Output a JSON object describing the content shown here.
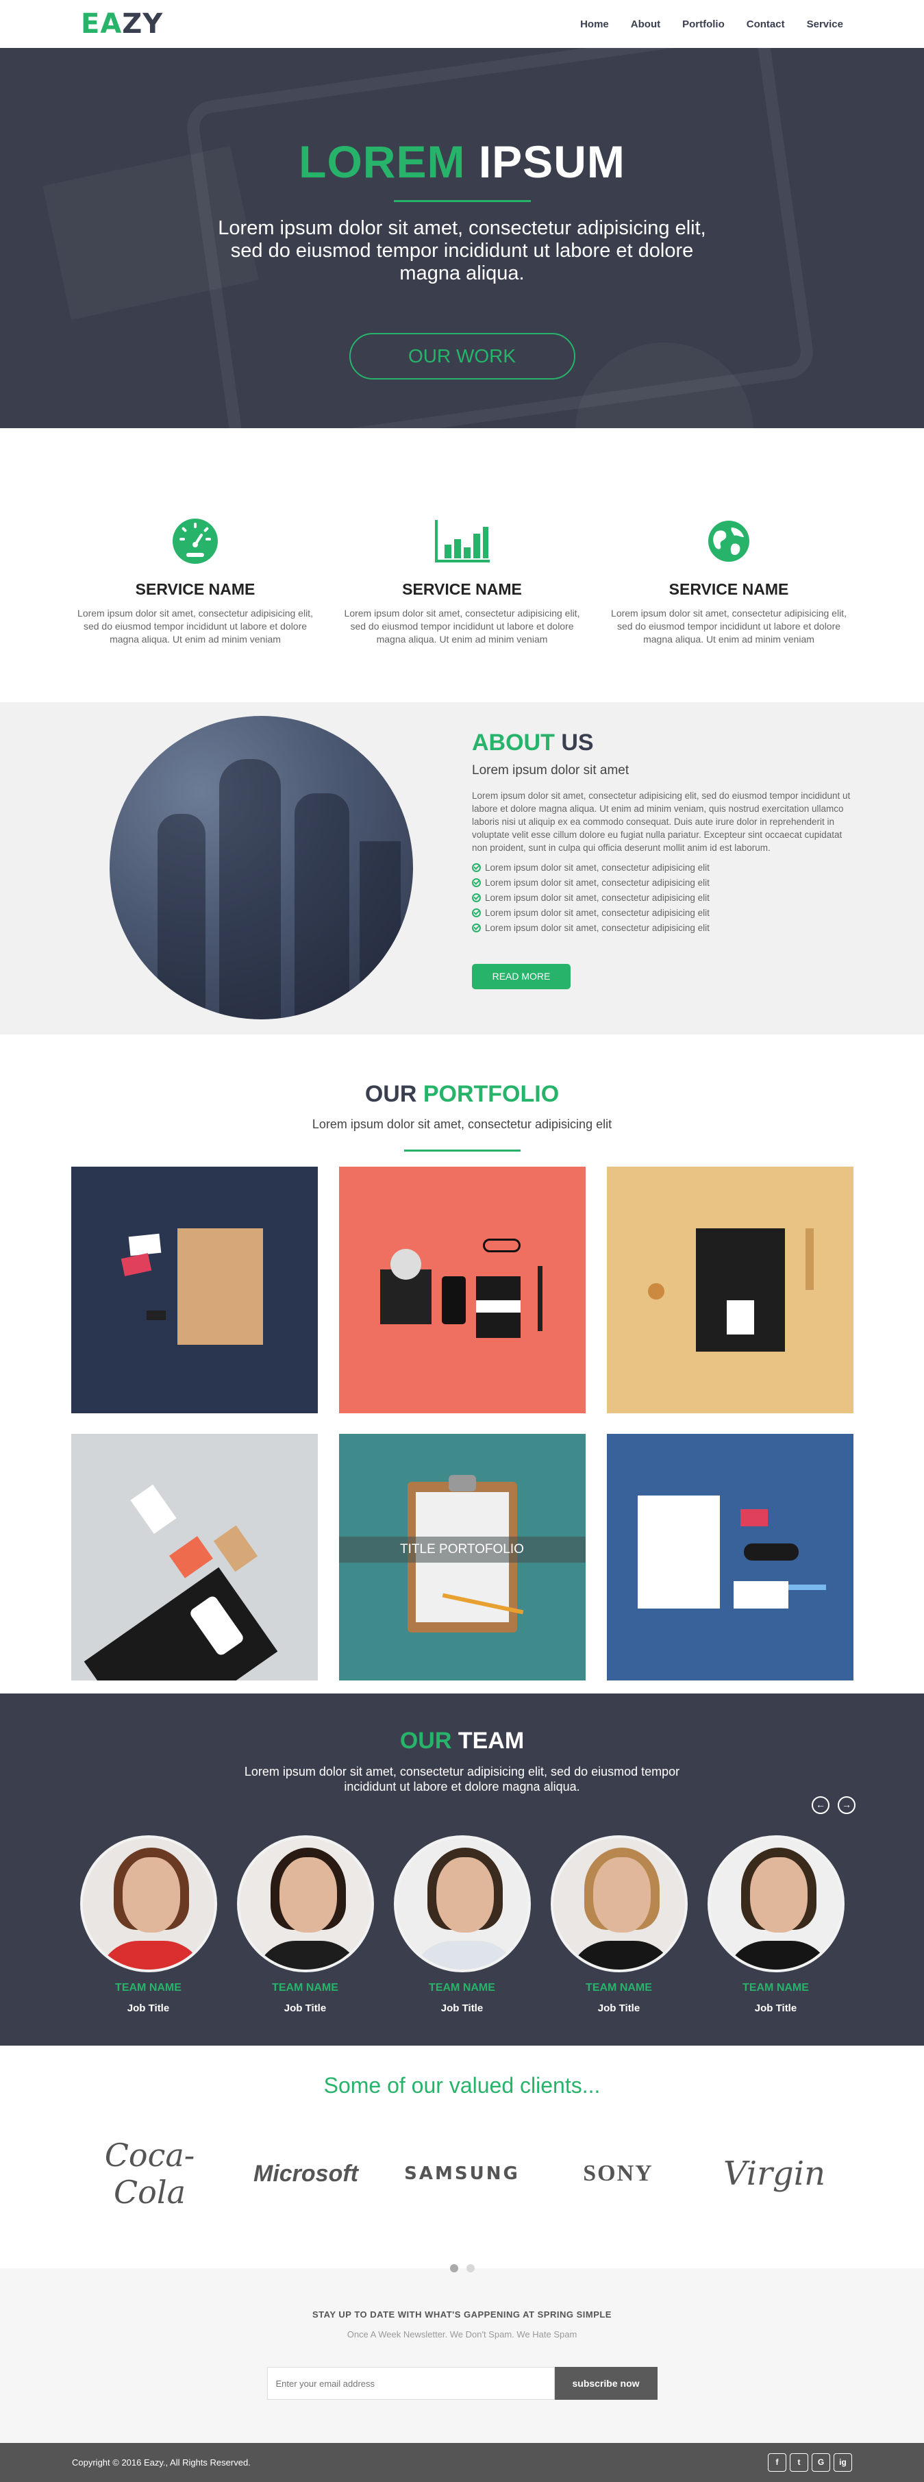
{
  "nav": {
    "logo_a": "EA",
    "logo_b": "ZY",
    "items": [
      "Home",
      "About",
      "Portfolio",
      "Contact",
      "Service"
    ]
  },
  "hero": {
    "title_green": "LOREM",
    "title_white": "IPSUM",
    "subtitle": "Lorem ipsum dolor sit amet, consectetur adipisicing elit, sed do eiusmod tempor incididunt ut labore et dolore magna aliqua.",
    "button": "OUR WORK"
  },
  "services": [
    {
      "icon": "gauge-icon",
      "title": "SERVICE NAME",
      "text": "Lorem ipsum dolor sit amet, consectetur adipisicing elit, sed do eiusmod tempor incididunt ut labore et dolore magna aliqua. Ut enim ad minim veniam"
    },
    {
      "icon": "bar-chart-icon",
      "title": "SERVICE NAME",
      "text": "Lorem ipsum dolor sit amet, consectetur adipisicing elit, sed do eiusmod tempor incididunt ut labore et dolore magna aliqua. Ut enim ad minim veniam"
    },
    {
      "icon": "globe-icon",
      "title": "SERVICE NAME",
      "text": "Lorem ipsum dolor sit amet, consectetur adipisicing elit, sed do eiusmod tempor incididunt ut labore et dolore magna aliqua. Ut enim ad minim veniam"
    }
  ],
  "about": {
    "title_green": "ABOUT",
    "title_dark": "US",
    "subtitle": "Lorem ipsum dolor sit amet",
    "paragraph": "Lorem ipsum dolor sit amet, consectetur adipisicing elit, sed do eiusmod tempor incididunt ut labore et dolore magna aliqua. Ut enim ad minim veniam, quis nostrud exercitation ullamco laboris nisi ut aliquip ex ea commodo consequat. Duis aute irure dolor in reprehenderit in voluptate velit esse cillum dolore eu fugiat nulla pariatur. Excepteur sint occaecat cupidatat non proident, sunt in culpa qui officia deserunt mollit anim id est laborum.",
    "list": [
      "Lorem ipsum dolor sit amet, consectetur adipisicing elit",
      "Lorem ipsum dolor sit amet, consectetur adipisicing elit",
      "Lorem ipsum dolor sit amet, consectetur adipisicing elit",
      "Lorem ipsum dolor sit amet, consectetur adipisicing elit",
      "Lorem ipsum dolor sit amet, consectetur adipisicing elit"
    ],
    "button": "READ MORE"
  },
  "portfolio": {
    "title_dark": "OUR",
    "title_green": "PORTFOLIO",
    "subtitle": "Lorem ipsum dolor sit amet, consectetur adipisicing elit",
    "hover_caption": "TITLE PORTOFOLIO",
    "tile_colors": [
      "#2a3550",
      "#ef7060",
      "#e8c383",
      "#d2d6d8",
      "#3f8a8a",
      "#3a629a"
    ]
  },
  "team": {
    "title_green": "OUR",
    "title_white": "TEAM",
    "subtitle": "Lorem ipsum dolor sit amet, consectetur adipisicing elit, sed do eiusmod tempor incididunt ut labore et dolore magna aliqua.",
    "members": [
      {
        "name": "TEAM NAME",
        "role": "Job Title",
        "hair": "#6b3a22",
        "body": "#d9302f",
        "bg": "#e9e6e3"
      },
      {
        "name": "TEAM NAME",
        "role": "Job Title",
        "hair": "#2a1a14",
        "body": "#1d1d1d",
        "bg": "#ece9e6"
      },
      {
        "name": "TEAM NAME",
        "role": "Job Title",
        "hair": "#3b2a1e",
        "body": "#dfe4ea",
        "bg": "#eeeeee"
      },
      {
        "name": "TEAM NAME",
        "role": "Job Title",
        "hair": "#b8864f",
        "body": "#161616",
        "bg": "#eae7e4"
      },
      {
        "name": "TEAM NAME",
        "role": "Job Title",
        "hair": "#3a2a1c",
        "body": "#151515",
        "bg": "#efefef"
      }
    ]
  },
  "clients": {
    "title": "Some of our valued clients...",
    "logos": [
      "Coca-Cola",
      "Microsoft",
      "SAMSUNG",
      "SONY",
      "Virgin"
    ]
  },
  "newsletter": {
    "heading": "STAY UP TO DATE WITH WHAT'S GAPPENING AT SPRING SIMPLE",
    "tagline": "Once A Week Newsletter. We Don't Spam. We Hate Spam",
    "placeholder": "Enter your email address",
    "button": "subscribe now"
  },
  "footer": {
    "copyright": "Copyright © 2016 Eazy., All Rights Reserved.",
    "socials": [
      "f",
      "t",
      "G",
      "ig"
    ]
  },
  "colors": {
    "accent": "#27b36a",
    "dark": "#3b3f4d"
  }
}
